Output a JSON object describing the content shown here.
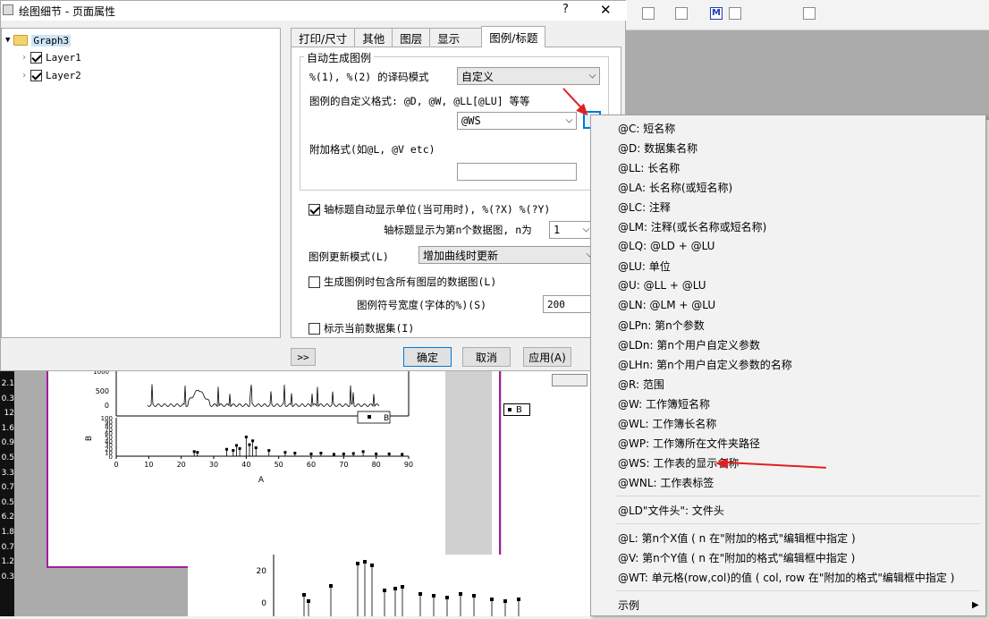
{
  "dialog": {
    "title": "绘图细节 - 页面属性",
    "help_label": "?",
    "close_label": "✕",
    "tree": [
      {
        "label": "Graph3",
        "expanded": true
      },
      {
        "label": "Layer1",
        "checked": true
      },
      {
        "label": "Layer2",
        "checked": true
      }
    ],
    "tabs": [
      "打印/尺寸",
      "其他",
      "图层",
      "显示",
      "图例/标题"
    ],
    "active_tab": "图例/标题",
    "auto_group_title": "自动生成图例",
    "translate_mode_label": "%(1), %(2) 的译码模式",
    "translate_mode_value": "自定义",
    "custom_format_label": "图例的自定义格式: @D, @W, @LL[@LU] 等等",
    "custom_format_value": "@WS",
    "arrow_button_label": "›",
    "extra_format_label": "附加格式(如@L, @V etc)",
    "extra_format_value": "",
    "axis_unit_label": "轴标题自动显示单位(当可用时), %(?X) %(?Y)",
    "axis_unit_checked": true,
    "axis_nth_label": "轴标题显示为第n个数据图, n为",
    "axis_nth_value": "1",
    "update_mode_label": "图例更新模式(L)",
    "update_mode_value": "增加曲线时更新",
    "include_all_label": "生成图例时包含所有图层的数据图(L)",
    "include_all_checked": false,
    "symbol_width_label": "图例符号宽度(字体的%)(S)",
    "symbol_width_value": "200",
    "mark_current_label": "标示当前数据集(I)",
    "mark_current_checked": false,
    "expand_button_label": ">>",
    "ok_label": "确定",
    "cancel_label": "取消",
    "apply_label": "应用(A)"
  },
  "menu": {
    "items": [
      "@C: 短名称",
      "@D: 数据集名称",
      "@LL: 长名称",
      "@LA: 长名称(或短名称)",
      "@LC: 注释",
      "@LM: 注释(或长名称或短名称)",
      "@LQ: @LD + @LU",
      "@LU: 单位",
      "@U: @LL + @LU",
      "@LN: @LM + @LU",
      "@LPn: 第n个参数",
      "@LDn: 第n个用户自定义参数",
      "@LHn: 第n个用户自定义参数的名称",
      "@R: 范围",
      "@W: 工作簿短名称",
      "@WL: 工作簿长名称",
      "@WP: 工作簿所在文件夹路径",
      "@WS: 工作表的显示名称",
      "@WNL: 工作表标签"
    ],
    "group2": [
      "@LD\"文件头\": 文件头"
    ],
    "group3": [
      "@L: 第n个X值 ( n 在\"附加的格式\"编辑框中指定 )",
      "@V: 第n个Y值 ( n 在\"附加的格式\"编辑框中指定 )",
      "@WT: 单元格(row,col)的值 ( col, row 在\"附加的格式\"编辑框中指定 )"
    ],
    "examples_label": "示例",
    "submenu_arrow": "▶"
  },
  "background": {
    "row_numbers": [
      "2.1",
      "0.3",
      "12",
      "1.6",
      "0.9",
      "0.5",
      "3.3",
      "0.7",
      "0.5",
      "6.2",
      "1.8",
      "0.7",
      "1.2",
      "0.3"
    ],
    "graph": {
      "top_axis_ticks": [
        "500",
        "0"
      ],
      "top_axis_extra": "1000",
      "bottom_y_ticks": [
        "100",
        "90",
        "80",
        "70",
        "60",
        "50",
        "40",
        "30",
        "20",
        "10",
        "0"
      ],
      "x_ticks": [
        "0",
        "10",
        "20",
        "30",
        "40",
        "50",
        "60",
        "70",
        "80",
        "90"
      ],
      "x_label": "A",
      "y_label": "B",
      "legend_label": "B",
      "legend2_label": "B"
    },
    "bottom_plot_ticks": [
      "20",
      "0"
    ]
  }
}
